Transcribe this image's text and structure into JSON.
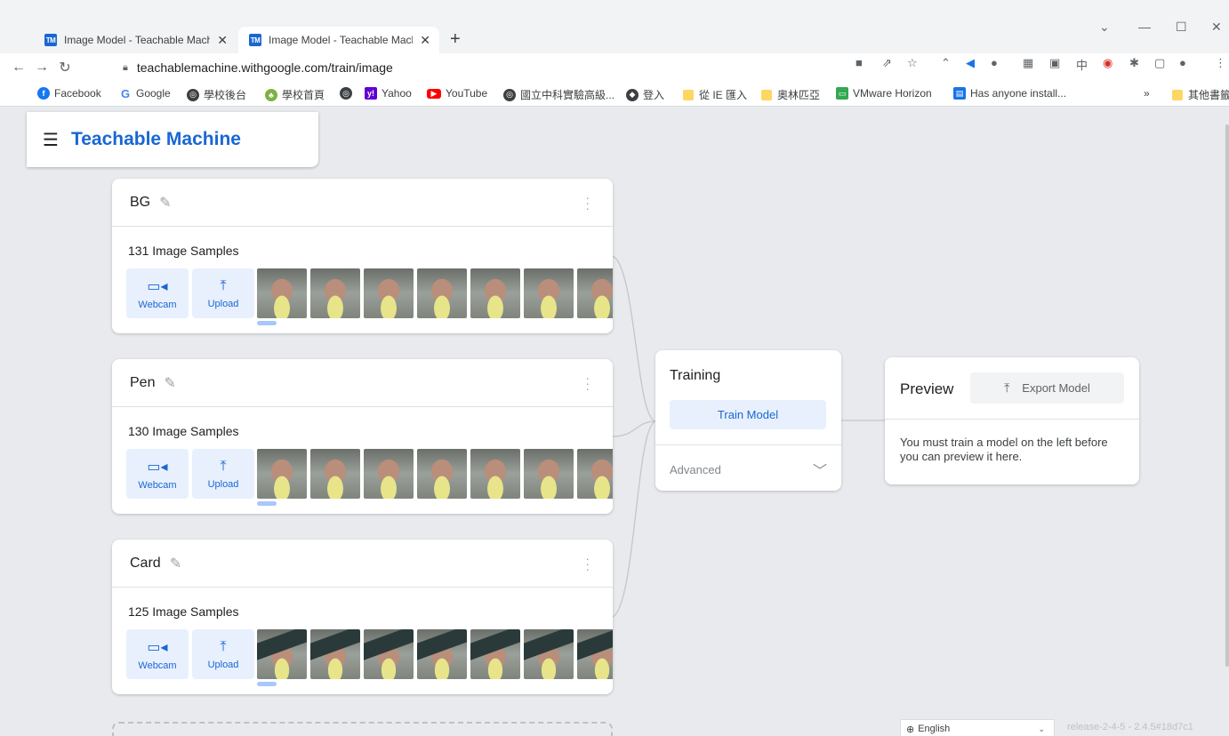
{
  "browser": {
    "tabs": [
      {
        "title": "Image Model - Teachable Mach",
        "favicon": "TM",
        "active": false
      },
      {
        "title": "Image Model - Teachable Mach",
        "favicon": "TM",
        "active": true
      }
    ],
    "url": "teachablemachine.withgoogle.com/train/image",
    "bookmarks": [
      {
        "label": "Facebook",
        "icon": "facebook-icon",
        "color": "#1877f2"
      },
      {
        "label": "Google",
        "icon": "google-icon",
        "color": "#4285f4"
      },
      {
        "label": "學校後台",
        "icon": "globe-icon",
        "color": "#3c4043"
      },
      {
        "label": "學校首頁",
        "icon": "school-icon",
        "color": "#7cb342"
      },
      {
        "label": "",
        "icon": "globe-icon",
        "color": "#3c4043"
      },
      {
        "label": "Yahoo",
        "icon": "yahoo-icon",
        "color": "#6001d2"
      },
      {
        "label": "YouTube",
        "icon": "youtube-icon",
        "color": "#ff0000"
      },
      {
        "label": "國立中科實驗高級...",
        "icon": "globe-icon",
        "color": "#3c4043"
      },
      {
        "label": "登入",
        "icon": "login-icon",
        "color": "#3c4043"
      },
      {
        "label": "從 IE 匯入",
        "icon": "folder-icon",
        "color": "#fdd663"
      },
      {
        "label": "奧林匹亞",
        "icon": "folder-icon",
        "color": "#fdd663"
      },
      {
        "label": "VMware Horizon",
        "icon": "vmware-icon",
        "color": "#34a853"
      },
      {
        "label": "Has anyone install...",
        "icon": "bookmark-icon",
        "color": "#1a73e8"
      },
      {
        "label": "其他書籤",
        "icon": "folder-icon",
        "color": "#fdd663"
      }
    ],
    "more_bookmarks": "»"
  },
  "app": {
    "title": "Teachable Machine",
    "classes": [
      {
        "name": "BG",
        "samples_label": "131 Image Samples",
        "thumb_count": 7,
        "thumb_style": "face"
      },
      {
        "name": "Pen",
        "samples_label": "130 Image Samples",
        "thumb_count": 7,
        "thumb_style": "face"
      },
      {
        "name": "Card",
        "samples_label": "125 Image Samples",
        "thumb_count": 7,
        "thumb_style": "card"
      }
    ],
    "webcam_label": "Webcam",
    "upload_label": "Upload",
    "training": {
      "title": "Training",
      "train_button": "Train Model",
      "advanced_label": "Advanced"
    },
    "preview": {
      "title": "Preview",
      "export_button": "Export Model",
      "message": "You must train a model on the left before you can preview it here."
    },
    "footer": {
      "language": "English",
      "release": "release-2-4-5 - 2.4.5#18d7c1"
    }
  },
  "colors": {
    "brand_blue": "#1967d2",
    "button_bg": "#e8f0fe",
    "page_bg": "#e8eaed"
  }
}
